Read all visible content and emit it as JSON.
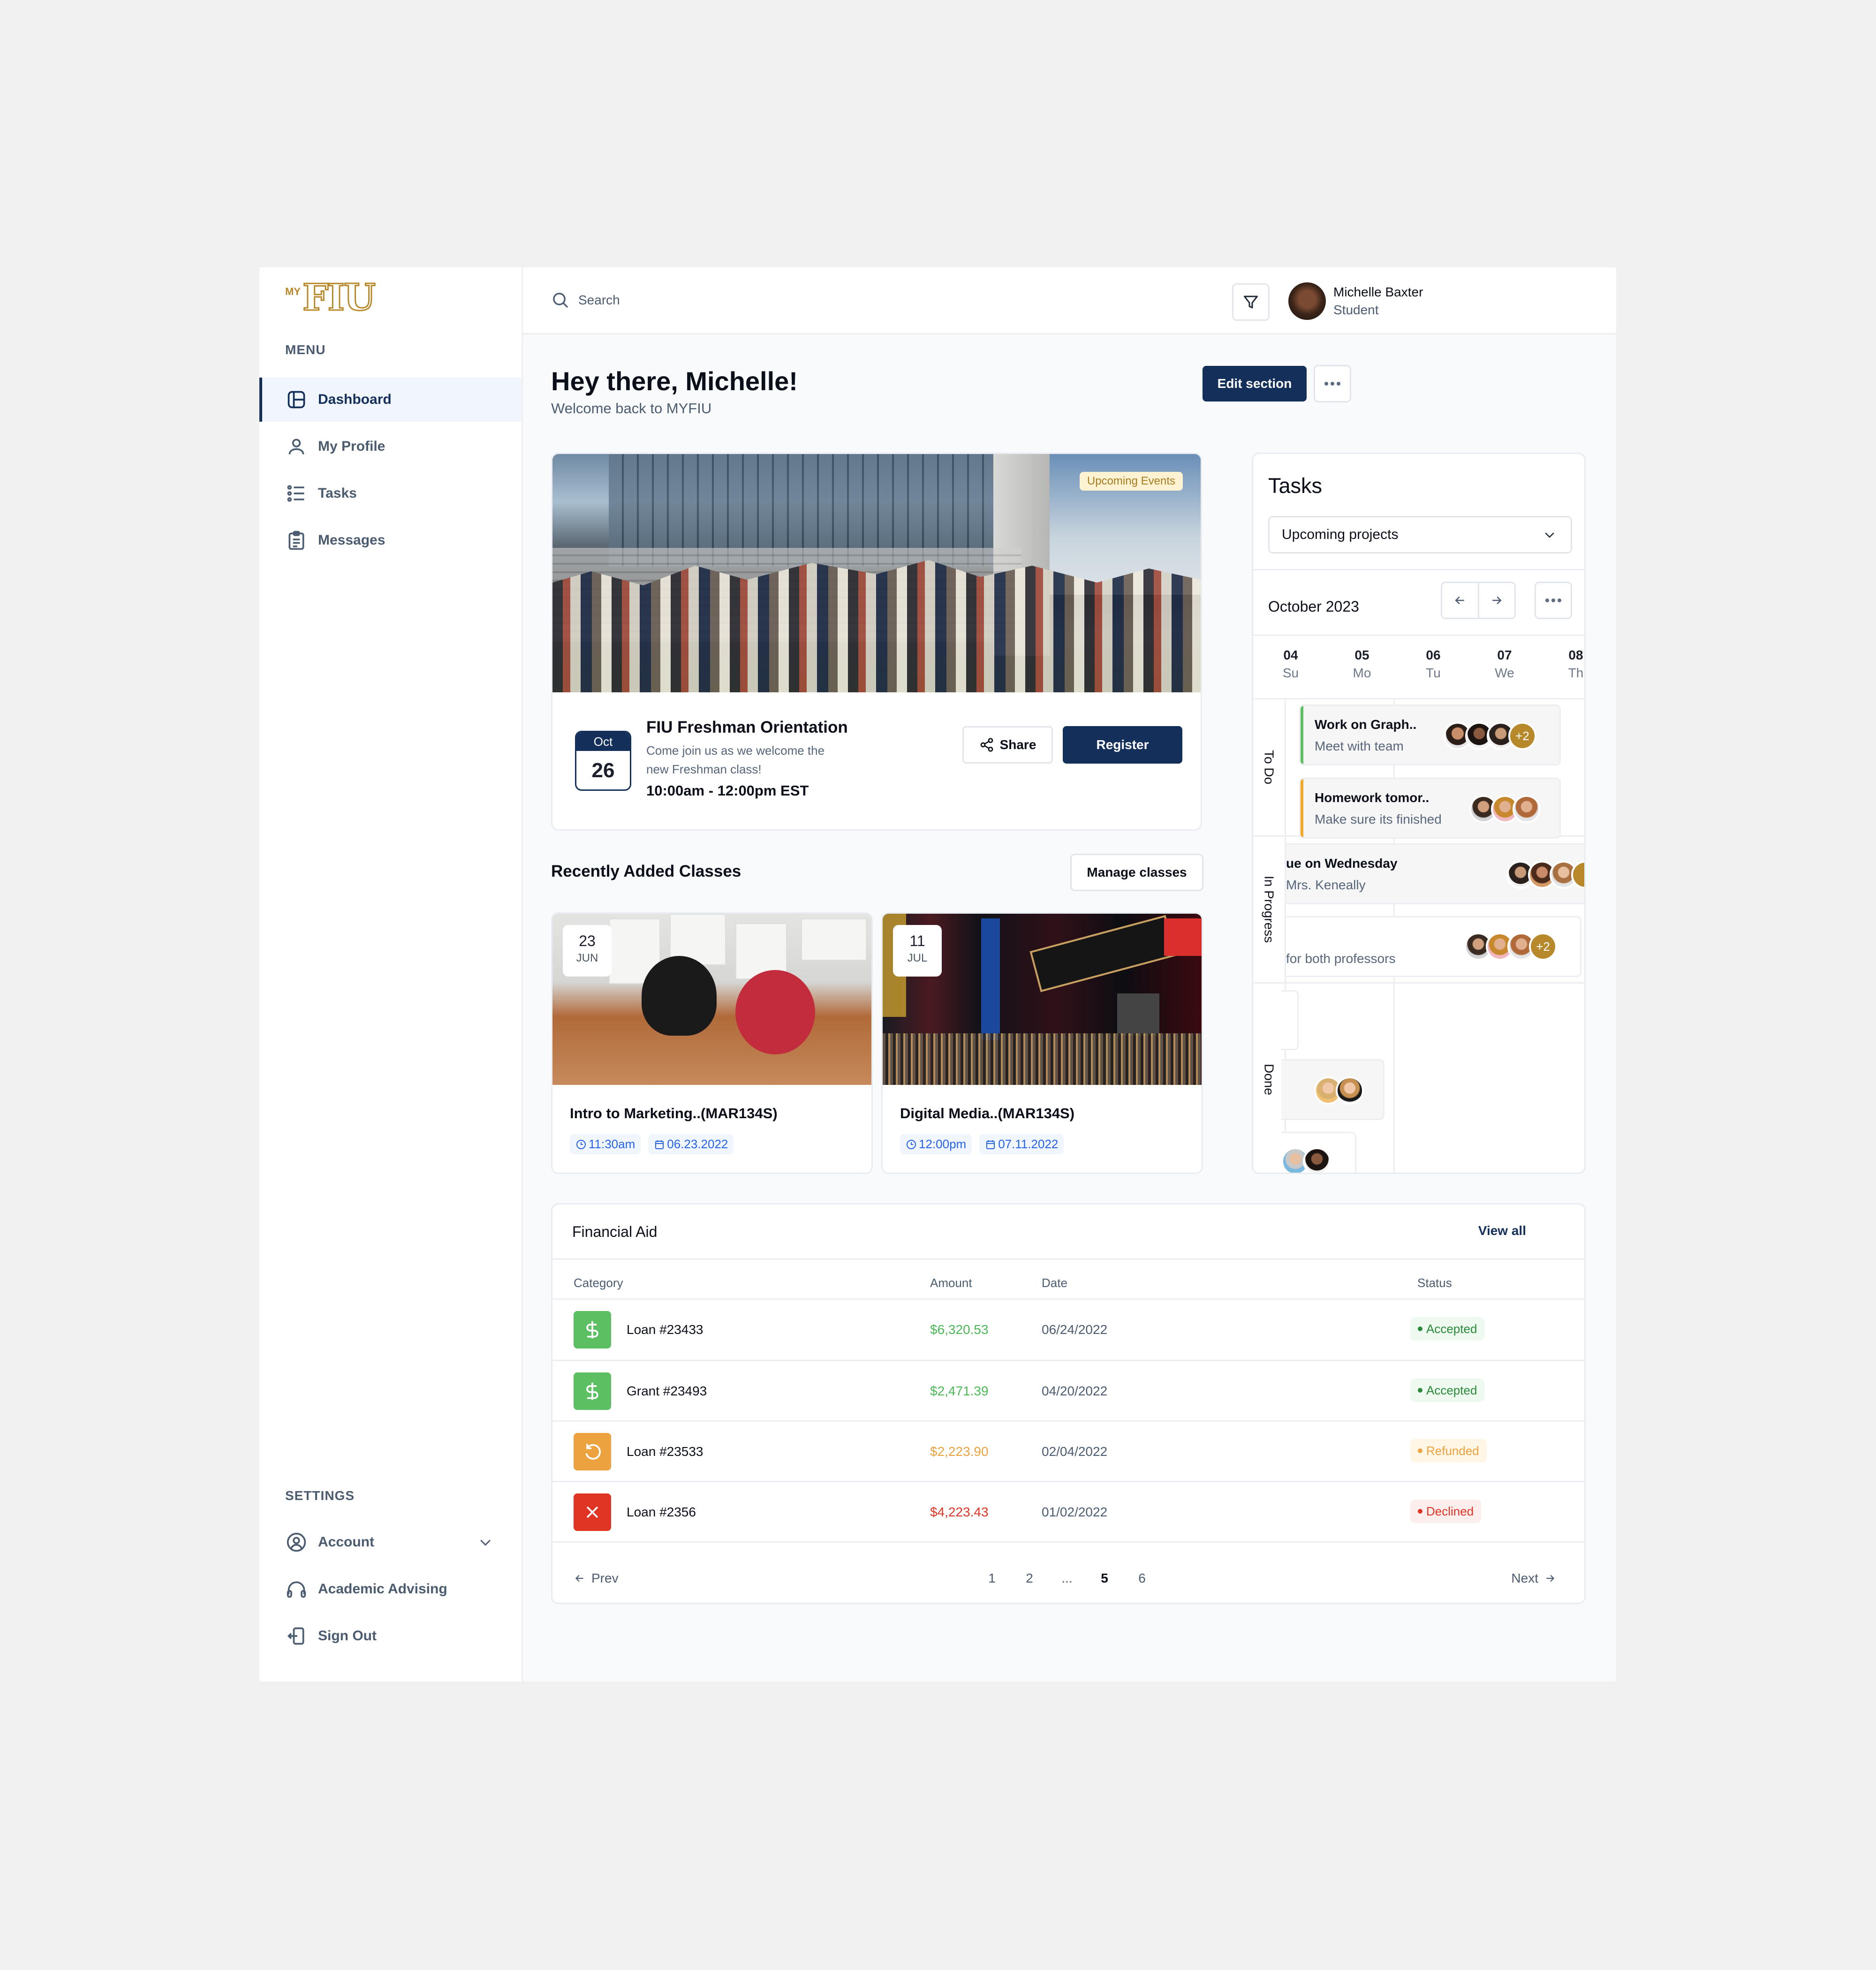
{
  "brand": {
    "prefix": "MY",
    "name": "FIU",
    "color": "#b8892b"
  },
  "sidebar": {
    "menu_label": "MENU",
    "items": [
      {
        "label": "Dashboard",
        "icon": "layout-icon",
        "active": true
      },
      {
        "label": "My Profile",
        "icon": "user-icon"
      },
      {
        "label": "Tasks",
        "icon": "list-icon"
      },
      {
        "label": "Messages",
        "icon": "clipboard-icon"
      }
    ],
    "settings_label": "SETTINGS",
    "settings_items": [
      {
        "label": "Account",
        "icon": "user-circle-icon",
        "has_dropdown": true
      },
      {
        "label": "Academic Advising",
        "icon": "headphones-icon"
      },
      {
        "label": "Sign Out",
        "icon": "sign-out-icon"
      }
    ]
  },
  "topbar": {
    "search_placeholder": "Search",
    "user": {
      "name": "Michelle Baxter",
      "role": "Student"
    }
  },
  "header": {
    "title": "Hey there, Michelle!",
    "subtitle": "Welcome back to MYFIU",
    "edit_label": "Edit section"
  },
  "event": {
    "badge": "Upcoming Events",
    "month": "Oct",
    "day": "26",
    "title": "FIU Freshman Orientation",
    "description": "Come join us as we welcome the new Freshman class!",
    "time": "10:00am - 12:00pm EST",
    "share_label": "Share",
    "register_label": "Register"
  },
  "classes": {
    "title": "Recently Added Classes",
    "manage_label": "Manage classes",
    "items": [
      {
        "day": "23",
        "month": "JUN",
        "title": "Intro to Marketing..(MAR134S)",
        "time": "11:30am",
        "date": "06.23.2022"
      },
      {
        "day": "11",
        "month": "JUL",
        "title": "Digital Media..(MAR134S)",
        "time": "12:00pm",
        "date": "07.11.2022"
      }
    ]
  },
  "tasks": {
    "title": "Tasks",
    "filter": "Upcoming projects",
    "month": "October 2023",
    "days": [
      {
        "num": "04",
        "wd": "Su"
      },
      {
        "num": "05",
        "wd": "Mo"
      },
      {
        "num": "06",
        "wd": "Tu"
      },
      {
        "num": "07",
        "wd": "We"
      },
      {
        "num": "08",
        "wd": "Th"
      }
    ],
    "lanes": [
      "To Do",
      "In Progress",
      "Done"
    ],
    "cards": [
      {
        "title": "Work on Graph..",
        "subtitle": "Meet with team",
        "accent": "#5cbf62",
        "extra": "+2"
      },
      {
        "title": "Homework tomor..",
        "subtitle": "Make sure its finished",
        "accent": "#f5a623"
      },
      {
        "title": "ue on Wednesday",
        "subtitle": "Mrs. Keneally"
      },
      {
        "title": "",
        "subtitle": "for both professors",
        "extra": "+2"
      }
    ]
  },
  "financial_aid": {
    "title": "Financial Aid",
    "view_all": "View all",
    "columns": [
      "Category",
      "Amount",
      "Date",
      "Status"
    ],
    "rows": [
      {
        "category": "Loan #23433",
        "amount": "$6,320.53",
        "date": "06/24/2022",
        "status": "Accepted",
        "icon": "dollar-icon",
        "color": "#5cbf62"
      },
      {
        "category": "Grant #23493",
        "amount": "$2,471.39",
        "date": "04/20/2022",
        "status": "Accepted",
        "icon": "dollar-icon",
        "color": "#5cbf62"
      },
      {
        "category": "Loan #23533",
        "amount": "$2,223.90",
        "date": "02/04/2022",
        "status": "Refunded",
        "icon": "refresh-icon",
        "color": "#eca23f"
      },
      {
        "category": "Loan #2356",
        "amount": "$4,223.43",
        "date": "01/02/2022",
        "status": "Declined",
        "icon": "x-icon",
        "color": "#e03424"
      }
    ],
    "pagination": {
      "prev": "Prev",
      "next": "Next",
      "pages": [
        "1",
        "2",
        "...",
        "5",
        "6"
      ],
      "current": "5"
    }
  },
  "colors": {
    "primary": "#14305a",
    "accepted": "#2a8a3a",
    "refunded": "#eca23f",
    "declined": "#e03424"
  }
}
